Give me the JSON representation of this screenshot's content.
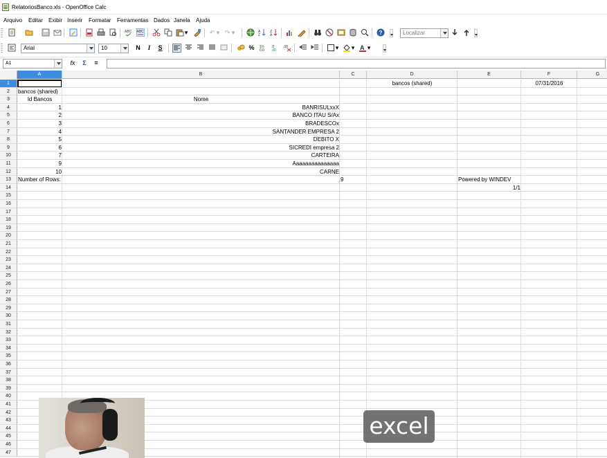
{
  "window": {
    "title": "RelatoriosBanco.xls - OpenOffice Calc"
  },
  "menu": [
    "Arquivo",
    "Editar",
    "Exibir",
    "Inserir",
    "Formatar",
    "Ferramentas",
    "Dados",
    "Janela",
    "Ajuda"
  ],
  "toolbar1": {
    "find_placeholder": "Localizar"
  },
  "toolbar2": {
    "font_name": "Arial",
    "font_size": "10",
    "bold": "N",
    "italic": "I",
    "underline": "S",
    "percent": "%"
  },
  "formula_bar": {
    "cell_ref": "A1",
    "fx": "fx",
    "sum": "Σ",
    "equals": "="
  },
  "grid": {
    "columns": [
      "A",
      "B",
      "C",
      "D",
      "E",
      "F",
      "G"
    ],
    "active_column": "A",
    "active_row": 1,
    "rows": [
      "1",
      "2",
      "3",
      "4",
      "5",
      "6",
      "7",
      "8",
      "9",
      "10",
      "11",
      "12",
      "13",
      "14",
      "15",
      "16",
      "17",
      "18",
      "19",
      "20",
      "21",
      "22",
      "23",
      "24",
      "25",
      "26",
      "27",
      "28",
      "29",
      "30",
      "31",
      "32",
      "33",
      "34",
      "35",
      "36",
      "37",
      "38",
      "39",
      "40",
      "41",
      "42",
      "43",
      "44",
      "45",
      "46",
      "47"
    ],
    "cells": {
      "D1": "bancos (shared)",
      "F1": "07/31/2016",
      "A2": "bancos (shared)",
      "A3": "Id Bancos",
      "B3": "Nome",
      "A4": "1",
      "B4": "BANRISULxxX",
      "A5": "2",
      "B5": "BANCO ITAU S/Ax",
      "A6": "3",
      "B6": "BRADESCOx",
      "A7": "4",
      "B7": "SANTANDER EMPRESA 2",
      "A8": "5",
      "B8": "DEBITO X",
      "A9": "6",
      "B9": "SICREDI empresa 2",
      "A10": "7",
      "B10": "CARTEIRA",
      "A11": "9",
      "B11": "Aaaaaaaaaaaaaaa",
      "A12": "10",
      "B12": "CARNE",
      "A13": "Number of Rows:",
      "C13": "9",
      "E13": "Powered by WINDEV",
      "E14": "1/1"
    }
  },
  "overlay": {
    "caption": "excel"
  }
}
